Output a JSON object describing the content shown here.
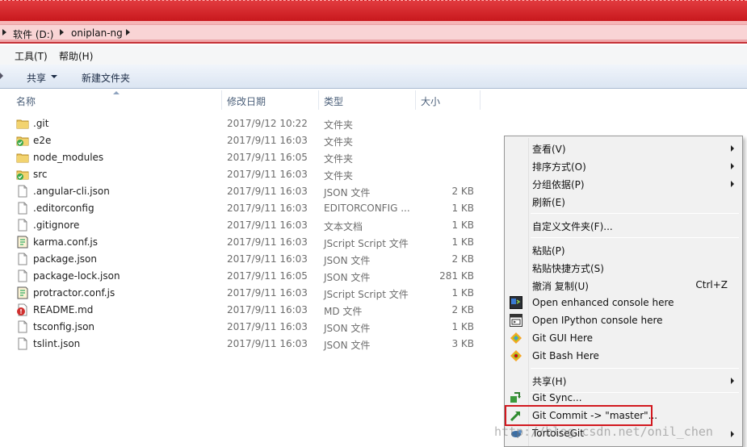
{
  "address": {
    "drive": "软件 (D:)",
    "folder": "oniplan-ng"
  },
  "menubar": {
    "tools": "工具(T)",
    "help": "帮助(H)"
  },
  "toolbar": {
    "share": "共享",
    "new_folder": "新建文件夹"
  },
  "columns": {
    "name": "名称",
    "modified": "修改日期",
    "type": "类型",
    "size": "大小"
  },
  "files": [
    {
      "name": ".git",
      "modified": "2017/9/12 10:22",
      "type": "文件夹",
      "size": "",
      "icon": "folder-icon"
    },
    {
      "name": "e2e",
      "modified": "2017/9/11 16:03",
      "type": "文件夹",
      "size": "",
      "icon": "folder-check-icon"
    },
    {
      "name": "node_modules",
      "modified": "2017/9/11 16:05",
      "type": "文件夹",
      "size": "",
      "icon": "folder-icon"
    },
    {
      "name": "src",
      "modified": "2017/9/11 16:03",
      "type": "文件夹",
      "size": "",
      "icon": "folder-check-icon"
    },
    {
      "name": ".angular-cli.json",
      "modified": "2017/9/11 16:03",
      "type": "JSON 文件",
      "size": "2 KB",
      "icon": "file-icon"
    },
    {
      "name": ".editorconfig",
      "modified": "2017/9/11 16:03",
      "type": "EDITORCONFIG ...",
      "size": "1 KB",
      "icon": "file-icon"
    },
    {
      "name": ".gitignore",
      "modified": "2017/9/11 16:03",
      "type": "文本文档",
      "size": "1 KB",
      "icon": "file-icon"
    },
    {
      "name": "karma.conf.js",
      "modified": "2017/9/11 16:03",
      "type": "JScript Script 文件",
      "size": "1 KB",
      "icon": "script-icon"
    },
    {
      "name": "package.json",
      "modified": "2017/9/11 16:03",
      "type": "JSON 文件",
      "size": "2 KB",
      "icon": "file-icon"
    },
    {
      "name": "package-lock.json",
      "modified": "2017/9/11 16:05",
      "type": "JSON 文件",
      "size": "281 KB",
      "icon": "file-icon"
    },
    {
      "name": "protractor.conf.js",
      "modified": "2017/9/11 16:03",
      "type": "JScript Script 文件",
      "size": "1 KB",
      "icon": "script-icon"
    },
    {
      "name": "README.md",
      "modified": "2017/9/11 16:03",
      "type": "MD 文件",
      "size": "2 KB",
      "icon": "git-modified-icon"
    },
    {
      "name": "tsconfig.json",
      "modified": "2017/9/11 16:03",
      "type": "JSON 文件",
      "size": "1 KB",
      "icon": "file-icon"
    },
    {
      "name": "tslint.json",
      "modified": "2017/9/11 16:03",
      "type": "JSON 文件",
      "size": "3 KB",
      "icon": "file-icon"
    }
  ],
  "context_menu": {
    "view": "查看(V)",
    "sort_by": "排序方式(O)",
    "group_by": "分组依据(P)",
    "refresh": "刷新(E)",
    "customize": "自定义文件夹(F)...",
    "paste": "粘贴(P)",
    "paste_shortcut": "粘贴快捷方式(S)",
    "undo_copy": "撤消 复制(U)",
    "undo_shortcut": "Ctrl+Z",
    "enhanced_console": "Open enhanced console here",
    "ipython_console": "Open IPython console here",
    "git_gui": "Git GUI Here",
    "git_bash": "Git Bash Here",
    "share": "共享(H)",
    "git_sync": "Git Sync...",
    "git_commit": "Git Commit -> \"master\"...",
    "tortoise_git": "TortoiseGit"
  },
  "watermark": "http://blog.csdn.net/onil_chen",
  "colors": {
    "title_red": "#d42227",
    "highlight_red": "#d2181f",
    "toolbar_blue": "#dbe5f2"
  }
}
